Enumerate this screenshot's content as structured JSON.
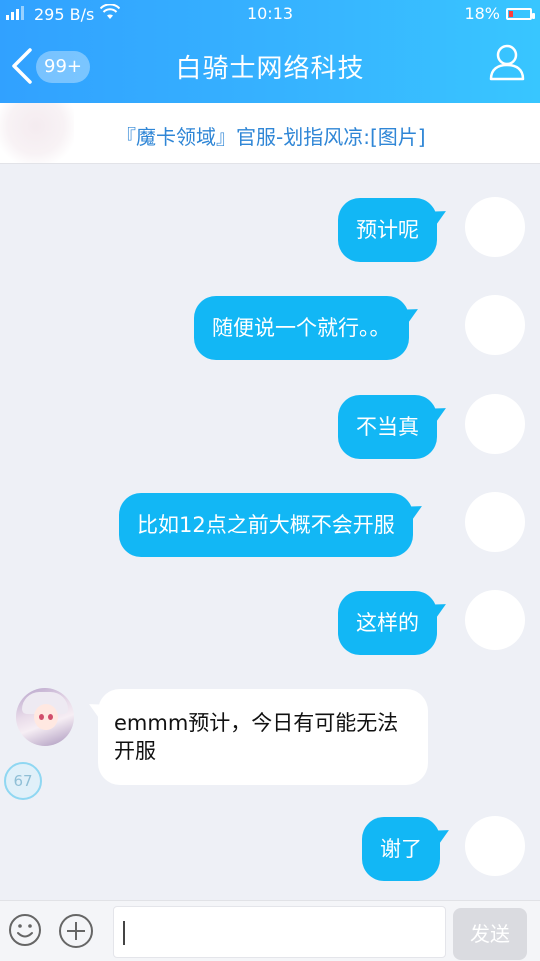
{
  "status_bar": {
    "network": "295 B/s",
    "time": "10:13",
    "battery": "18%",
    "battery_level": 0.18
  },
  "header": {
    "unread_count": "99+",
    "title": "白骑士网络科技"
  },
  "announcement": {
    "text": "『魔卡领域』官服-划指风凉:[图片]"
  },
  "messages": [
    {
      "side": "right",
      "text": "预计呢"
    },
    {
      "side": "right",
      "text": "随便说一个就行。。"
    },
    {
      "side": "right",
      "text": "不当真"
    },
    {
      "side": "right",
      "text": "比如12点之前大概不会开服"
    },
    {
      "side": "right",
      "text": "这样的"
    },
    {
      "side": "left",
      "text": "emmm预计，今日有可能无法开服"
    },
    {
      "side": "right",
      "text": "谢了"
    }
  ],
  "floating_badge": "67",
  "input": {
    "value": "",
    "send_label": "发送"
  },
  "colors": {
    "header_blue": "#31a1ff",
    "bubble_blue": "#12b7f5",
    "chat_bg": "#eef0f6"
  },
  "icons": [
    "signal-icon",
    "wifi-icon",
    "battery-icon",
    "back-icon",
    "profile-icon",
    "emoji-icon",
    "plus-icon"
  ]
}
